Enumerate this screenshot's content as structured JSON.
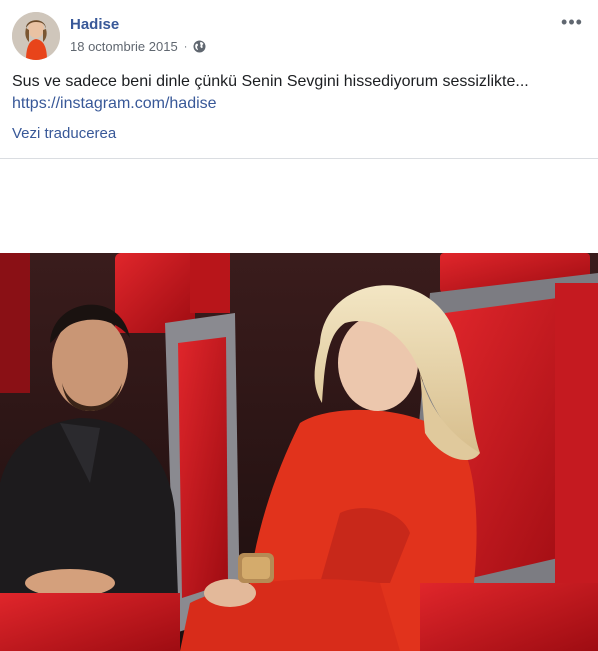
{
  "post": {
    "author": "Hadise",
    "date": "18 octombrie 2015",
    "separator": "·",
    "privacy_icon": "globe-icon",
    "more_icon": "more-options-icon",
    "more_label": "•••",
    "text": "Sus ve sadece beni dinle çünkü Senin Sevgini hissediyorum sessizlikte...",
    "link": "https://instagram.com/hadise",
    "translate": "Vezi traducerea"
  },
  "colors": {
    "link_blue": "#385898",
    "meta_gray": "#606770",
    "chair_red": "#c8141a"
  }
}
